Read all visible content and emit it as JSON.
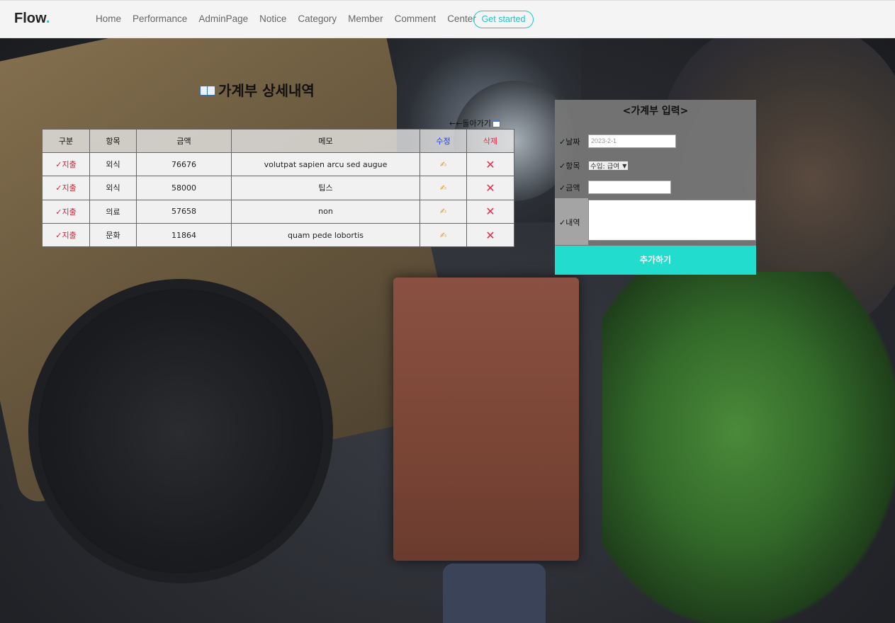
{
  "nav": {
    "logo": "Flow",
    "logo_dot": ".",
    "items": [
      "Home",
      "Performance",
      "AdminPage",
      "Notice",
      "Category",
      "Member",
      "Comment",
      "Center"
    ],
    "cta": "Get started"
  },
  "page": {
    "title": "가계부 상세내역",
    "back_label": "←←돌아가기"
  },
  "table": {
    "headers": [
      "구분",
      "항목",
      "금액",
      "메모",
      "수정",
      "삭제"
    ],
    "rows": [
      {
        "type": "✓지출",
        "category": "외식",
        "amount": "76676",
        "memo": "volutpat sapien arcu sed augue"
      },
      {
        "type": "✓지출",
        "category": "외식",
        "amount": "58000",
        "memo": "팁스"
      },
      {
        "type": "✓지출",
        "category": "의료",
        "amount": "57658",
        "memo": "non"
      },
      {
        "type": "✓지출",
        "category": "문화",
        "amount": "11864",
        "memo": "quam pede lobortis"
      }
    ]
  },
  "form": {
    "title": "<가계부 입력>",
    "check": "✓",
    "date_label": "날짜",
    "date_placeholder": "2023-2-1",
    "item_label": "항목",
    "item_selected": "수입: 급여",
    "amount_label": "금액",
    "amount_value": "",
    "detail_label": "내역",
    "submit_label": "추가하기"
  },
  "colors": {
    "accent": "#22c5c3",
    "submit_bg": "#22dcce",
    "edit_header": "#1a3df0",
    "delete_color": "#e0304a",
    "expense_color": "#c5283b"
  }
}
